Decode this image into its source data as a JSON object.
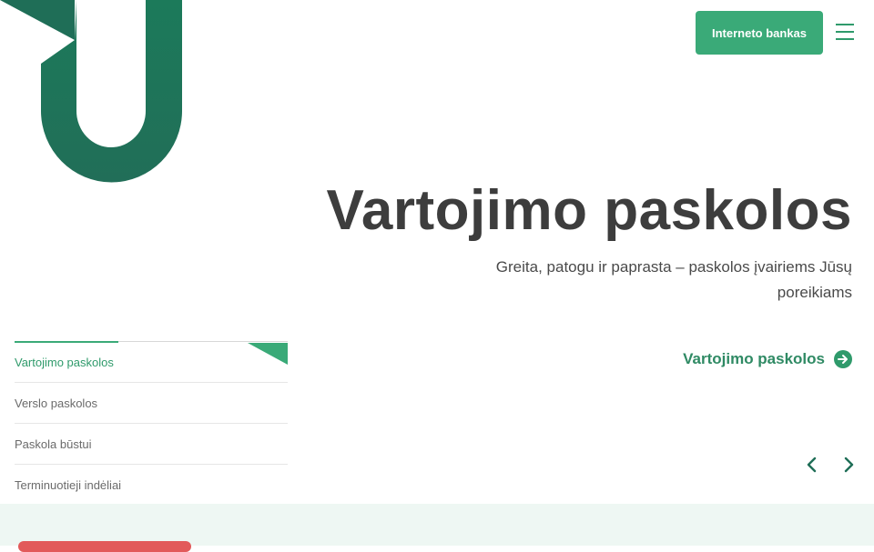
{
  "header": {
    "bank_button_label": "Interneto bankas",
    "menu_icon": "hamburger-menu-icon"
  },
  "hero": {
    "title": "Vartojimo paskolos",
    "subtitle": "Greita, patogu ir paprasta – paskolos įvairiems Jūsų poreikiams",
    "cta_label": "Vartojimo paskolos",
    "cta_icon": "arrow-right-circle-icon"
  },
  "tabs": [
    {
      "label": "Vartojimo paskolos",
      "active": true
    },
    {
      "label": "Verslo paskolos",
      "active": false
    },
    {
      "label": "Paskola būstui",
      "active": false
    },
    {
      "label": "Terminuotieji indėliai",
      "active": false
    }
  ],
  "carousel": {
    "prev_icon": "chevron-left-icon",
    "next_icon": "chevron-right-icon"
  },
  "colors": {
    "brand_green": "#3aaa78",
    "dark_green": "#1f6e57",
    "text_dark": "#3d3d3d",
    "band_bg": "#eef7f3",
    "accent_red": "#e25a5a"
  }
}
